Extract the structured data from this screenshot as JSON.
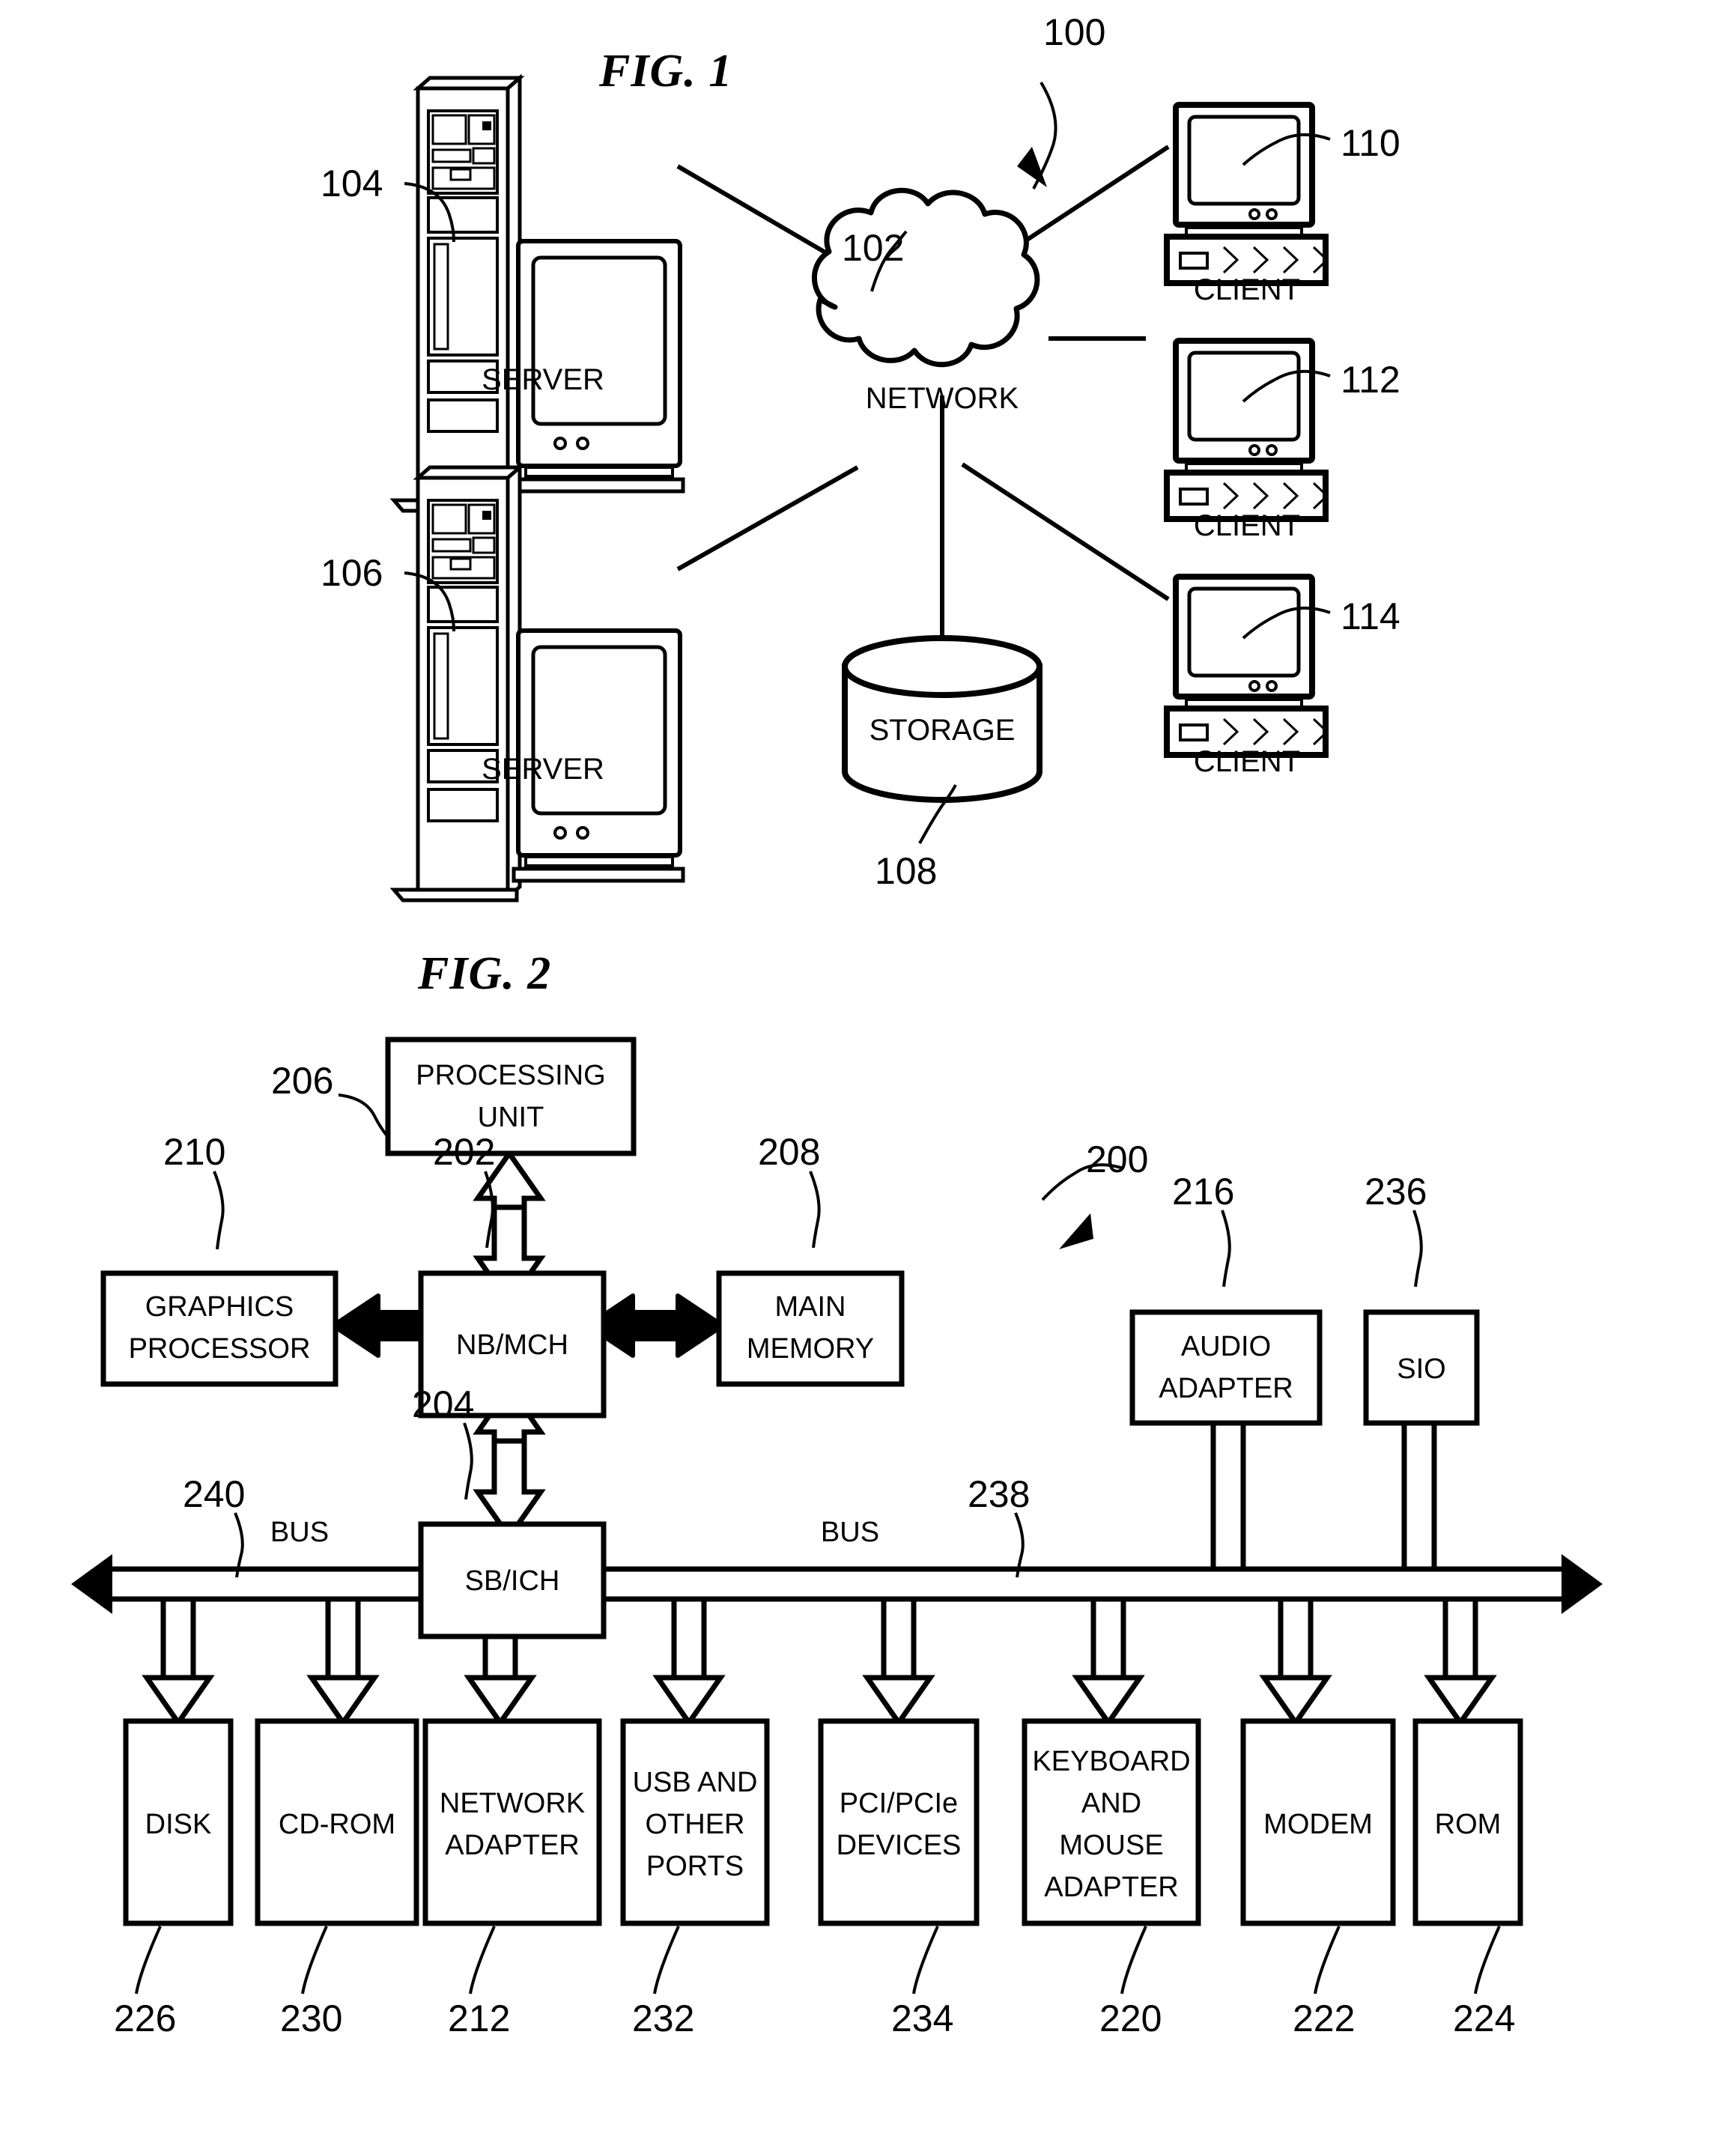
{
  "figures": [
    {
      "id": "fig1",
      "title": "FIG. 1",
      "system_ref": "100",
      "network": {
        "label": "NETWORK",
        "ref": "102"
      },
      "storage": {
        "label": "STORAGE",
        "ref": "108"
      },
      "servers": [
        {
          "label": "SERVER",
          "ref": "104"
        },
        {
          "label": "SERVER",
          "ref": "106"
        }
      ],
      "clients": [
        {
          "label": "CLIENT",
          "ref": "110"
        },
        {
          "label": "CLIENT",
          "ref": "112"
        },
        {
          "label": "CLIENT",
          "ref": "114"
        }
      ]
    },
    {
      "id": "fig2",
      "title": "FIG. 2",
      "system_ref": "200",
      "blocks": [
        {
          "name": "processing-unit",
          "lines": [
            "PROCESSING",
            "UNIT"
          ],
          "ref": "206"
        },
        {
          "name": "graphics-processor",
          "lines": [
            "GRAPHICS",
            "PROCESSOR"
          ],
          "ref": "210"
        },
        {
          "name": "nb-mch",
          "lines": [
            "NB/MCH"
          ],
          "ref": "202"
        },
        {
          "name": "main-memory",
          "lines": [
            "MAIN",
            "MEMORY"
          ],
          "ref": "208"
        },
        {
          "name": "audio-adapter",
          "lines": [
            "AUDIO",
            "ADAPTER"
          ],
          "ref": "216"
        },
        {
          "name": "sio",
          "lines": [
            "SIO"
          ],
          "ref": "236"
        },
        {
          "name": "sb-ich",
          "lines": [
            "SB/ICH"
          ],
          "ref": "204"
        },
        {
          "name": "disk",
          "lines": [
            "DISK"
          ],
          "ref": "226"
        },
        {
          "name": "cd-rom",
          "lines": [
            "CD-ROM"
          ],
          "ref": "230"
        },
        {
          "name": "network-adapter",
          "lines": [
            "NETWORK",
            "ADAPTER"
          ],
          "ref": "212"
        },
        {
          "name": "usb-and-other-ports",
          "lines": [
            "USB AND",
            "OTHER",
            "PORTS"
          ],
          "ref": "232"
        },
        {
          "name": "pci-pcie-devices",
          "lines": [
            "PCI/PCIe",
            "DEVICES"
          ],
          "ref": "234"
        },
        {
          "name": "keyboard-and-mouse-adapter",
          "lines": [
            "KEYBOARD",
            "AND",
            "MOUSE",
            "ADAPTER"
          ],
          "ref": "220"
        },
        {
          "name": "modem",
          "lines": [
            "MODEM"
          ],
          "ref": "222"
        },
        {
          "name": "rom",
          "lines": [
            "ROM"
          ],
          "ref": "224"
        }
      ],
      "buses": [
        {
          "name": "bus-left",
          "label": "BUS",
          "ref": "240"
        },
        {
          "name": "bus-right",
          "label": "BUS",
          "ref": "238"
        }
      ]
    }
  ],
  "text": {
    "fig1_title": "FIG. 1",
    "fig2_title": "FIG. 2",
    "network": "NETWORK",
    "storage": "STORAGE",
    "server": "SERVER",
    "client": "CLIENT",
    "bus": "BUS",
    "processing_unit_l1": "PROCESSING",
    "processing_unit_l2": "UNIT",
    "graphics_l1": "GRAPHICS",
    "graphics_l2": "PROCESSOR",
    "nbmch": "NB/MCH",
    "main_l1": "MAIN",
    "main_l2": "MEMORY",
    "audio_l1": "AUDIO",
    "audio_l2": "ADAPTER",
    "sio": "SIO",
    "sbich": "SB/ICH",
    "disk": "DISK",
    "cdrom": "CD-ROM",
    "netad_l1": "NETWORK",
    "netad_l2": "ADAPTER",
    "usb_l1": "USB AND",
    "usb_l2": "OTHER",
    "usb_l3": "PORTS",
    "pci_l1": "PCI/PCIe",
    "pci_l2": "DEVICES",
    "kbd_l1": "KEYBOARD",
    "kbd_l2": "AND",
    "kbd_l3": "MOUSE",
    "kbd_l4": "ADAPTER",
    "modem": "MODEM",
    "rom": "ROM"
  },
  "refs": {
    "r100": "100",
    "r102": "102",
    "r104": "104",
    "r106": "106",
    "r108": "108",
    "r110": "110",
    "r112": "112",
    "r114": "114",
    "r200": "200",
    "r202": "202",
    "r204": "204",
    "r206": "206",
    "r208": "208",
    "r210": "210",
    "r212": "212",
    "r216": "216",
    "r220": "220",
    "r222": "222",
    "r224": "224",
    "r226": "226",
    "r230": "230",
    "r232": "232",
    "r234": "234",
    "r236": "236",
    "r238": "238",
    "r240": "240"
  },
  "colors": {
    "ink": "#000000",
    "paper": "#ffffff"
  }
}
